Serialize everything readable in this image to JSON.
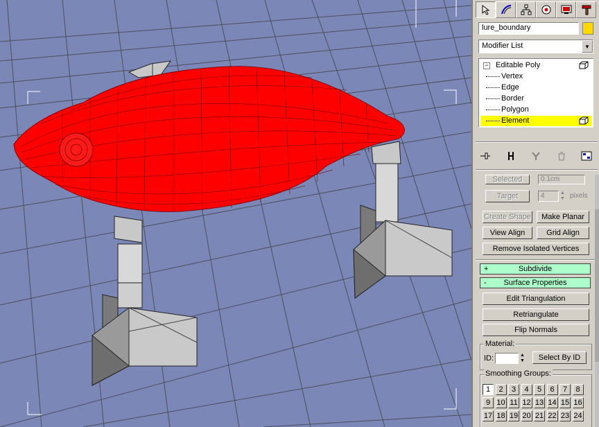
{
  "viewport": {
    "label": "Perspective viewport",
    "object_color": "#ff0000",
    "background_color": "#7b87b6",
    "grid_color": "#3c3c3c"
  },
  "command_panel": {
    "tabs": [
      {
        "name": "create-tab",
        "icon": "pointer-icon"
      },
      {
        "name": "modify-tab",
        "icon": "curve-icon"
      },
      {
        "name": "hierarchy-tab",
        "icon": "hierarchy-icon"
      },
      {
        "name": "motion-tab",
        "icon": "motion-icon"
      },
      {
        "name": "display-tab",
        "icon": "monitor-icon"
      },
      {
        "name": "utilities-tab",
        "icon": "hammer-icon"
      }
    ],
    "object_name": "lure_boundary",
    "object_color": "#ffd900",
    "modifier_list_label": "Modifier List",
    "stack": {
      "root": "Editable Poly",
      "items": [
        "Vertex",
        "Edge",
        "Border",
        "Polygon",
        "Element"
      ],
      "selected": "Element"
    },
    "edit_geometry": {
      "selected_label": "Selected",
      "selected_value": "0.1cm",
      "target_label": "Target",
      "target_value": "4",
      "pixels_label": "pixels",
      "create_shape": "Create Shape",
      "make_planar": "Make Planar",
      "view_align": "View Align",
      "grid_align": "Grid Align",
      "remove_isolated": "Remove Isolated Vertices"
    },
    "subdivide": {
      "sign": "+",
      "label": "Subdivide"
    },
    "surface_properties": {
      "sign": "-",
      "label": "Surface Properties",
      "edit_triangulation": "Edit Triangulation",
      "retriangulate": "Retriangulate",
      "flip_normals": "Flip Normals",
      "material_label": "Material:",
      "id_label": "ID:",
      "id_value": "",
      "select_by_id": "Select By ID",
      "smoothing_label": "Smoothing Groups:",
      "smoothing_row1": [
        "1",
        "2",
        "3",
        "4",
        "5",
        "6",
        "7",
        "8"
      ],
      "smoothing_row2": [
        "9",
        "10",
        "11",
        "12",
        "13",
        "14",
        "15",
        "16"
      ],
      "smoothing_row3": [
        "17",
        "18",
        "19",
        "20",
        "21",
        "22",
        "23",
        "24"
      ]
    }
  }
}
